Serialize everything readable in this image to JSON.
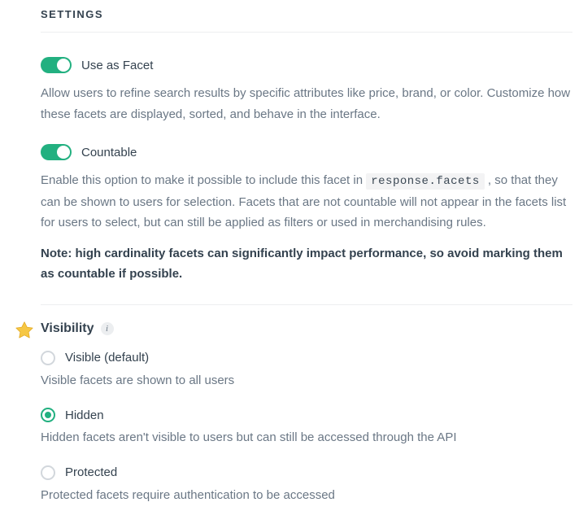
{
  "section_title": "SETTINGS",
  "facet": {
    "toggle_on": true,
    "label": "Use as Facet",
    "description": "Allow users to refine search results by specific attributes like price, brand, or color. Customize how these facets are displayed, sorted, and behave in the interface."
  },
  "countable": {
    "toggle_on": true,
    "label": "Countable",
    "desc_pre": "Enable this option to make it possible to include this facet in ",
    "desc_code": "response.facets",
    "desc_post": " , so that they can be shown to users for selection. Facets that are not countable will not appear in the facets list for users to select, but can still be applied as filters or used in merchandising rules.",
    "note": "Note: high cardinality facets can significantly impact performance, so avoid marking them as countable if possible."
  },
  "visibility": {
    "title": "Visibility",
    "info_glyph": "i",
    "options": [
      {
        "label": "Visible (default)",
        "description": "Visible facets are shown to all users",
        "selected": false
      },
      {
        "label": "Hidden",
        "description": "Hidden facets aren't visible to users but can still be accessed through the API",
        "selected": true
      },
      {
        "label": "Protected",
        "description": "Protected facets require authentication to be accessed",
        "selected": false
      }
    ]
  }
}
